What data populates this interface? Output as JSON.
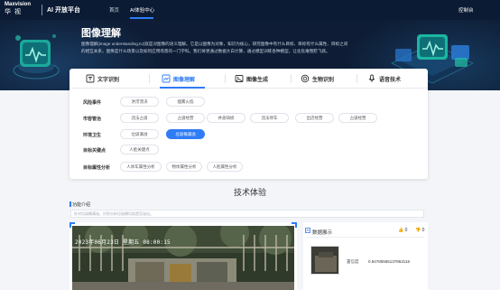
{
  "header": {
    "logo_brand": "Maxvision",
    "logo_cn": "华 视",
    "platform": "AI 开放平台",
    "nav": [
      {
        "label": "首页",
        "active": false
      },
      {
        "label": "AI体验中心",
        "active": true
      }
    ],
    "right_link": "控制台"
  },
  "hero": {
    "title": "图像理解",
    "description": "图像理解(image understanding,IU)就是对图像的语义理解。它是以图像为对象，知识为核心，研究图像中有什么目标、目标有什么属性、目标之间的相互关系，图像是什么场景以及如何应用场景的一门学科。我们将更通过数据大白计算，通过模型训练各种模型，让化危难而慰飞跃。"
  },
  "tabs": [
    {
      "label": "文字识别",
      "active": false,
      "icon": "text-recognition-icon"
    },
    {
      "label": "图像理解",
      "active": true,
      "icon": "image-understanding-icon"
    },
    {
      "label": "图像生成",
      "active": false,
      "icon": "image-generation-icon"
    },
    {
      "label": "生物识别",
      "active": false,
      "icon": "biometric-icon"
    },
    {
      "label": "语音技术",
      "active": false,
      "icon": "speech-icon"
    }
  ],
  "categories": [
    {
      "label": "风险事件",
      "items": [
        {
          "label": "洪涝溃决",
          "active": false
        },
        {
          "label": "烟雾火焰",
          "active": false
        }
      ]
    },
    {
      "label": "市容管治",
      "items": [
        {
          "label": "违法占道",
          "active": false
        },
        {
          "label": "占道经营",
          "active": false
        },
        {
          "label": "井盖缺损",
          "active": false
        },
        {
          "label": "违法停车",
          "active": false
        },
        {
          "label": "出店经营",
          "active": false
        },
        {
          "label": "占道经营",
          "active": false
        }
      ]
    },
    {
      "label": "环境卫生",
      "items": [
        {
          "label": "垃圾满溢",
          "active": false
        },
        {
          "label": "垃圾桶满溢",
          "active": true
        }
      ]
    },
    {
      "label": "目标关键点",
      "items": [
        {
          "label": "人脸关键点",
          "active": false
        }
      ]
    },
    {
      "label": "目标属性分析",
      "items": [
        {
          "label": "人体车属性分析",
          "active": false
        },
        {
          "label": "物体属性分析",
          "active": false
        },
        {
          "label": "人脸属性分析",
          "active": false
        }
      ]
    }
  ],
  "section": {
    "title": "技术体验",
    "function_label": "功能介绍",
    "function_desc": "针对垃圾桶满溢，识别分析垃圾桶垃圾是否溢出。"
  },
  "image": {
    "timestamp": "2023年06月23日 星期五 08:00:15"
  },
  "result": {
    "title": "数据展示",
    "likes": "0",
    "dislikes": "0",
    "key": "置信度",
    "value": "0.94785565137863116"
  },
  "colors": {
    "accent": "#2f7cf6",
    "nav_bg": "#0b1b33",
    "hero_bg": "#0e1d35"
  }
}
